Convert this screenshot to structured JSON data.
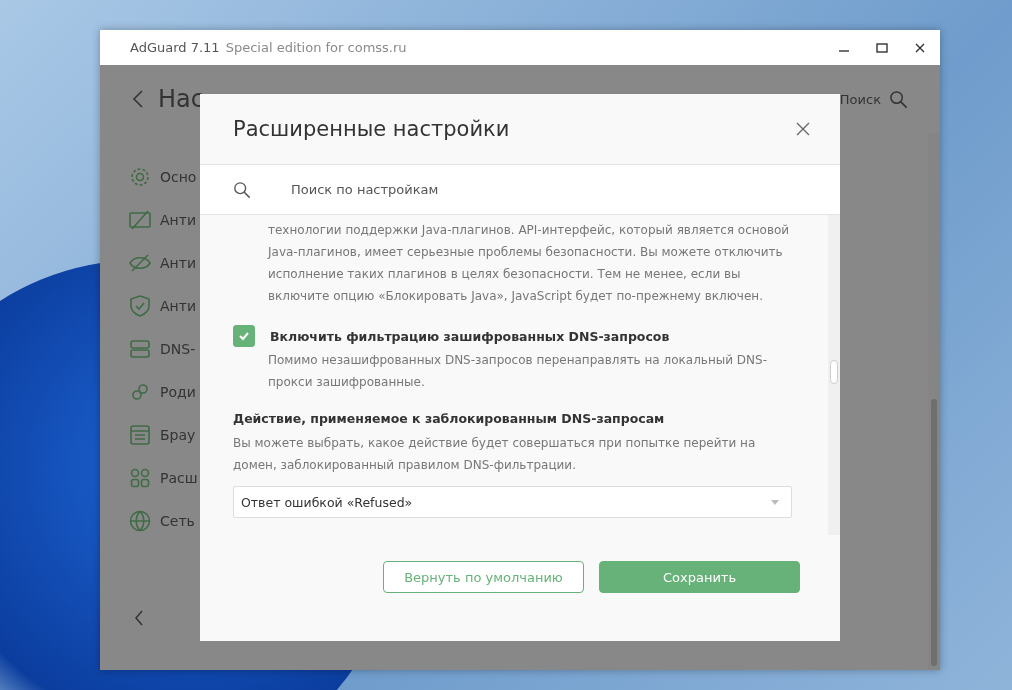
{
  "window": {
    "app_name": "AdGuard 7.11",
    "edition": "Special edition for comss.ru"
  },
  "page": {
    "title": "Нас",
    "search_label": "Поиск"
  },
  "sidebar": {
    "items": [
      {
        "label": "Осно"
      },
      {
        "label": "Анти"
      },
      {
        "label": "Анти"
      },
      {
        "label": "Анти"
      },
      {
        "label": "DNS-"
      },
      {
        "label": "Роди"
      },
      {
        "label": "Брау"
      },
      {
        "label": "Расш"
      },
      {
        "label": "Сеть"
      }
    ]
  },
  "dialog": {
    "title": "Расширенные настройки",
    "search": {
      "placeholder": "Поиск по настройкам"
    },
    "settings": [
      {
        "kind": "text",
        "description": "технологии поддержки Java-плагинов. API-интерфейс, который является основой Java-плагинов, имеет серьезные проблемы безопасности. Вы можете отключить исполнение таких плагинов в целях безопасности. Тем не менее, если вы включите опцию «Блокировать Java», JavaScript будет по-прежнему включен."
      },
      {
        "kind": "checkbox",
        "label": "Включить фильтрацию зашифрованных DNS-запросов",
        "checked": true,
        "description": "Помимо незашифрованных DNS-запросов перенаправлять на локальный DNS-прокси зашифрованные."
      },
      {
        "kind": "select",
        "label": "Действие, применяемое к заблокированным DNS-запросам",
        "description": "Вы можете выбрать, какое действие будет совершаться при попытке перейти на домен, заблокированный правилом DNS-фильтрации.",
        "value": "Ответ ошибкой «Refused»"
      }
    ],
    "buttons": [
      {
        "kind": "secondary",
        "label": "Вернуть по умолчанию"
      },
      {
        "kind": "primary",
        "label": "Сохранить"
      }
    ]
  }
}
